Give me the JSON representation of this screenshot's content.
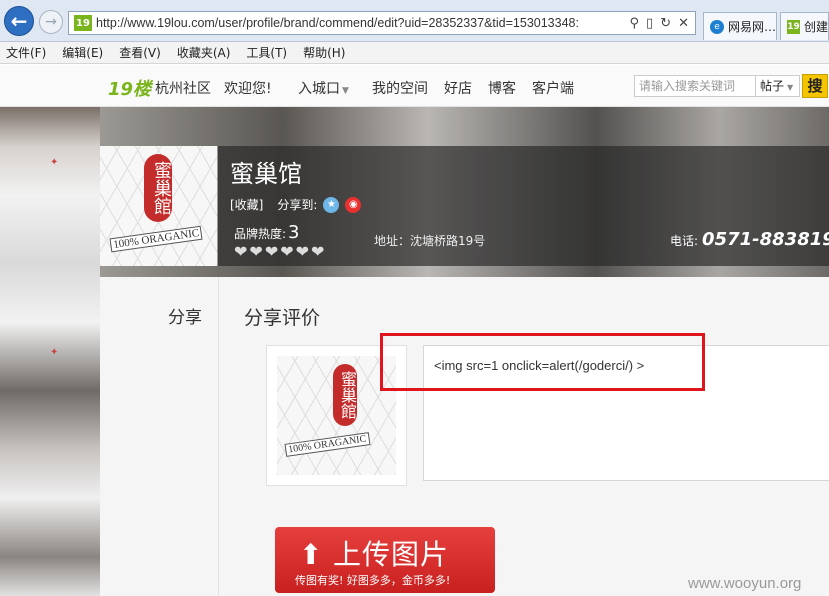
{
  "browser": {
    "url": "http://www.19lou.com/user/profile/brand/commend/edit?uid=28352337&tid=153013348:",
    "site_icon": "19",
    "tabs": [
      {
        "label": "网易网…",
        "icon": "ie-icon"
      },
      {
        "label": "创建",
        "icon": "19lou-icon"
      }
    ],
    "tab_close": "×",
    "menu": [
      "文件(F)",
      "编辑(E)",
      "查看(V)",
      "收藏夹(A)",
      "工具(T)",
      "帮助(H)"
    ]
  },
  "site_nav": {
    "logo": "19楼",
    "city": "杭州社区",
    "welcome": "欢迎您!",
    "entry": "入城口",
    "links": [
      "我的空间",
      "好店",
      "博客",
      "客户端"
    ],
    "search_placeholder": "请输入搜索关键词",
    "search_scope": "帖子",
    "search_button": "搜"
  },
  "brand": {
    "name": "蜜巢馆",
    "favorite": "[收藏]",
    "share_label": "分享到:",
    "heat_label": "品牌热度:",
    "heat_value": "3",
    "hearts": "❤❤❤❤❤❤",
    "address": "地址：沈塘桥路19号",
    "phone_label": "电话:",
    "phone": "0571-883819",
    "image_text": {
      "seal": "蜜巢館",
      "band": "100% ORAGANIC"
    }
  },
  "page": {
    "side_tab": "分享",
    "section_title": "分享评价",
    "comment_text": "<img src=1 onclick=alert(/goderci/) >",
    "upload_button": "上传图片",
    "upload_sub": "传图有奖! 好图多多，金币多多!",
    "watermark": "www.wooyun.org"
  },
  "colors": {
    "highlight_box": "#e0141c",
    "upload_button": "#c8201f",
    "brand_green": "#7ab51d",
    "search_button": "#f5c400"
  }
}
